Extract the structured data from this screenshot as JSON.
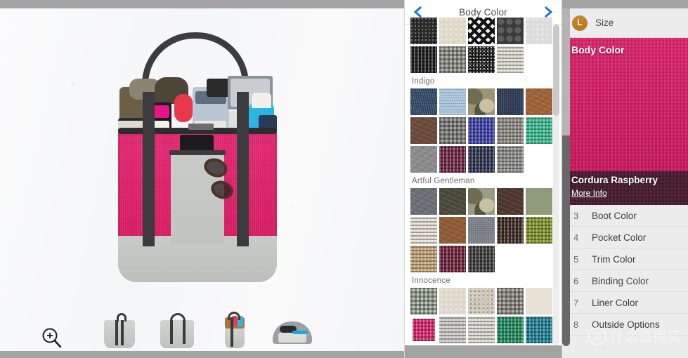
{
  "viewer": {
    "zoom_icon": "magnifier-plus-icon",
    "thumbnails": [
      {
        "name": "thumb-tote-side",
        "label": "Tote side view"
      },
      {
        "name": "thumb-tote-front",
        "label": "Tote front view"
      },
      {
        "name": "thumb-tote-packed",
        "label": "Tote packed view"
      },
      {
        "name": "thumb-tote-interior",
        "label": "Tote interior view"
      }
    ]
  },
  "swatch_panel": {
    "title": "Body Color",
    "prev_icon": "chevron-left-icon",
    "next_icon": "chevron-right-icon",
    "groups": [
      {
        "label": "",
        "swatches": [
          {
            "name": "black-speckle",
            "color": "#2a2a2a",
            "pattern": "speckle"
          },
          {
            "name": "cream-dot",
            "color": "#ded8c9",
            "pattern": "dot"
          },
          {
            "name": "chevron-black-white",
            "color": "#f0f0f0",
            "pattern": "chevron"
          },
          {
            "name": "charcoal-circles",
            "color": "#3a3a3a",
            "pattern": "circles"
          },
          {
            "name": "light-grey-dot",
            "color": "#dcdcdc",
            "pattern": "dot"
          },
          {
            "name": "jet-black-weave",
            "color": "#1e1e1e",
            "pattern": "weave"
          },
          {
            "name": "grey-check",
            "color": "#b9b9b2",
            "pattern": "check"
          },
          {
            "name": "black-static",
            "color": "#151515",
            "pattern": "static"
          },
          {
            "name": "bone-weave",
            "color": "#ddddd2",
            "pattern": "weave"
          }
        ]
      },
      {
        "label": "Indigo",
        "swatches": [
          {
            "name": "dark-denim",
            "color": "#2d4663",
            "pattern": "denim"
          },
          {
            "name": "light-denim",
            "color": "#a8c4de",
            "pattern": "denim"
          },
          {
            "name": "desert-camo",
            "color": "#9d9472",
            "pattern": "camo"
          },
          {
            "name": "navy-canvas",
            "color": "#2e3c55",
            "pattern": "canvas"
          },
          {
            "name": "tan-leather",
            "color": "#9e6338",
            "pattern": "leather"
          },
          {
            "name": "brown-leather",
            "color": "#6b4a39",
            "pattern": "leather"
          },
          {
            "name": "silver-check",
            "color": "#a9a9a6",
            "pattern": "check"
          },
          {
            "name": "royal-blue-weave",
            "color": "#3a41a8",
            "pattern": "weave"
          },
          {
            "name": "taupe-weave",
            "color": "#8d8b82",
            "pattern": "weave"
          },
          {
            "name": "mint-green-weave",
            "color": "#3bbd92",
            "pattern": "weave"
          },
          {
            "name": "grey-leather",
            "color": "#8c8c8c",
            "pattern": "leather"
          },
          {
            "name": "burgundy-weave",
            "color": "#6e2742",
            "pattern": "weave"
          },
          {
            "name": "midnight-navy-weave",
            "color": "#2b3450",
            "pattern": "weave"
          },
          {
            "name": "stone-grey-weave",
            "color": "#8b8b87",
            "pattern": "weave"
          }
        ]
      },
      {
        "label": "Artful Gentleman",
        "swatches": [
          {
            "name": "slate-leather",
            "color": "#6d6f74",
            "pattern": "leather"
          },
          {
            "name": "olive-leather",
            "color": "#4a4a3b",
            "pattern": "leather"
          },
          {
            "name": "digital-camo",
            "color": "#9a9a85",
            "pattern": "camo"
          },
          {
            "name": "espresso-leather",
            "color": "#4e3730",
            "pattern": "leather"
          },
          {
            "name": "sage-green",
            "color": "#8f9a7b",
            "pattern": "solid"
          },
          {
            "name": "ivory-weave",
            "color": "#e4e0d3",
            "pattern": "weave"
          },
          {
            "name": "saddle-leather",
            "color": "#8f5b33",
            "pattern": "leather"
          },
          {
            "name": "steel-grey",
            "color": "#7c8288",
            "pattern": "canvas"
          },
          {
            "name": "dark-brown-weave",
            "color": "#3d2a24",
            "pattern": "weave"
          },
          {
            "name": "moss-green-weave",
            "color": "#7f9428",
            "pattern": "weave"
          },
          {
            "name": "khaki-weave",
            "color": "#c0a474",
            "pattern": "weave"
          },
          {
            "name": "wine-red-weave",
            "color": "#71223a",
            "pattern": "weave"
          },
          {
            "name": "charcoal-weave",
            "color": "#3b3b3b",
            "pattern": "weave"
          }
        ]
      },
      {
        "label": "Innocence",
        "swatches": [
          {
            "name": "pale-sage-check",
            "color": "#c3cdbb",
            "pattern": "check"
          },
          {
            "name": "blush-dot",
            "color": "#dfd7cc",
            "pattern": "dot"
          },
          {
            "name": "sand-speckle",
            "color": "#cfc6b8",
            "pattern": "speckle"
          },
          {
            "name": "pepper-check",
            "color": "#b8b5ac",
            "pattern": "check"
          },
          {
            "name": "cream-solid",
            "color": "#e6e1d5",
            "pattern": "solid"
          },
          {
            "name": "cordura-raspberry",
            "color": "#d8216c",
            "pattern": "weave",
            "selected": true
          },
          {
            "name": "silver-grey-weave",
            "color": "#c9c8c4",
            "pattern": "weave"
          },
          {
            "name": "pearl-weave",
            "color": "#d9d6ce",
            "pattern": "weave"
          },
          {
            "name": "emerald-weave",
            "color": "#1f8a5e",
            "pattern": "weave"
          },
          {
            "name": "teal-weave",
            "color": "#1b7f96",
            "pattern": "weave"
          }
        ]
      }
    ]
  },
  "option_panel": {
    "size": {
      "badge": "L",
      "label": "Size"
    },
    "body_color": {
      "title": "Body Color",
      "selected_name": "Cordura Raspberry",
      "more_info": "More Info",
      "swatch_color": "#d8216c",
      "bar_color": "#4a1f32"
    },
    "rows": [
      {
        "num": "3",
        "name": "Boot Color"
      },
      {
        "num": "4",
        "name": "Pocket Color"
      },
      {
        "num": "5",
        "name": "Trim Color"
      },
      {
        "num": "6",
        "name": "Binding Color"
      },
      {
        "num": "7",
        "name": "Liner Color"
      },
      {
        "num": "8",
        "name": "Outside Options"
      }
    ]
  },
  "watermark": {
    "mark": "值",
    "text": "什么值得买"
  }
}
